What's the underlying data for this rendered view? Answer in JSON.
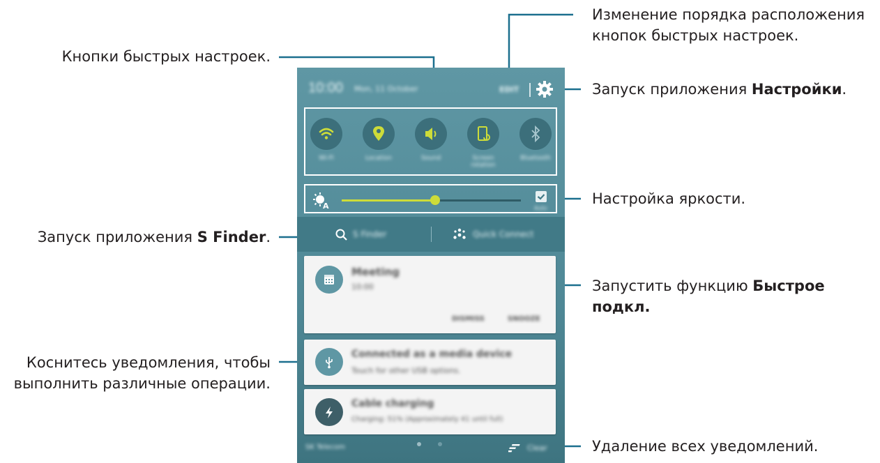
{
  "callouts": {
    "reorder_line1": "Изменение порядка расположения",
    "reorder_line2": "кнопок быстрых настроек.",
    "quick_buttons": "Кнопки быстрых настроек.",
    "settings_prefix": "Запуск приложения ",
    "settings_bold": "Настройки",
    "settings_suffix": ".",
    "brightness": "Настройка яркости.",
    "sfinder_prefix": "Запуск приложения ",
    "sfinder_bold": "S Finder",
    "sfinder_suffix": ".",
    "quickconnect_prefix": "Запустить функцию ",
    "quickconnect_bold1": "Быстрое",
    "quickconnect_bold2": "подкл.",
    "notif_line1": "Коснитесь уведомления, чтобы",
    "notif_line2": "выполнить различные операции.",
    "clear_all": "Удаление всех уведомлений."
  },
  "phone": {
    "time": "10:00",
    "date": "Mon, 11 October",
    "edit_label": "EDIT",
    "quick_settings": [
      {
        "label": "Wi-Fi",
        "icon": "wifi-icon"
      },
      {
        "label": "Location",
        "icon": "location-icon"
      },
      {
        "label": "Sound",
        "icon": "sound-icon"
      },
      {
        "label": "Screen rotation",
        "icon": "screen-rotation-icon"
      },
      {
        "label": "Bluetooth",
        "icon": "bluetooth-icon"
      }
    ],
    "brightness": {
      "level": 0.52,
      "auto_label": "Auto",
      "auto_checked": true
    },
    "s_finder_label": "S Finder",
    "quick_connect_label": "Quick Connect",
    "notifications": [
      {
        "title": "Meeting",
        "subtitle": "10:00",
        "actions": [
          "DISMISS",
          "SNOOZE"
        ],
        "icon": "calendar-icon"
      },
      {
        "title": "Connected as a media device",
        "subtitle": "Touch for other USB options.",
        "icon": "usb-icon"
      },
      {
        "title": "Cable charging",
        "subtitle": "Charging: 51% (Approximately 41 until full)",
        "icon": "charging-icon"
      }
    ],
    "carrier": "SK Telecom",
    "clear_label": "Clear"
  },
  "colors": {
    "accent": "#cddc39",
    "panel": "#4f8896",
    "highlight": "#ffffff",
    "leader_line": "#1b6f8e"
  }
}
